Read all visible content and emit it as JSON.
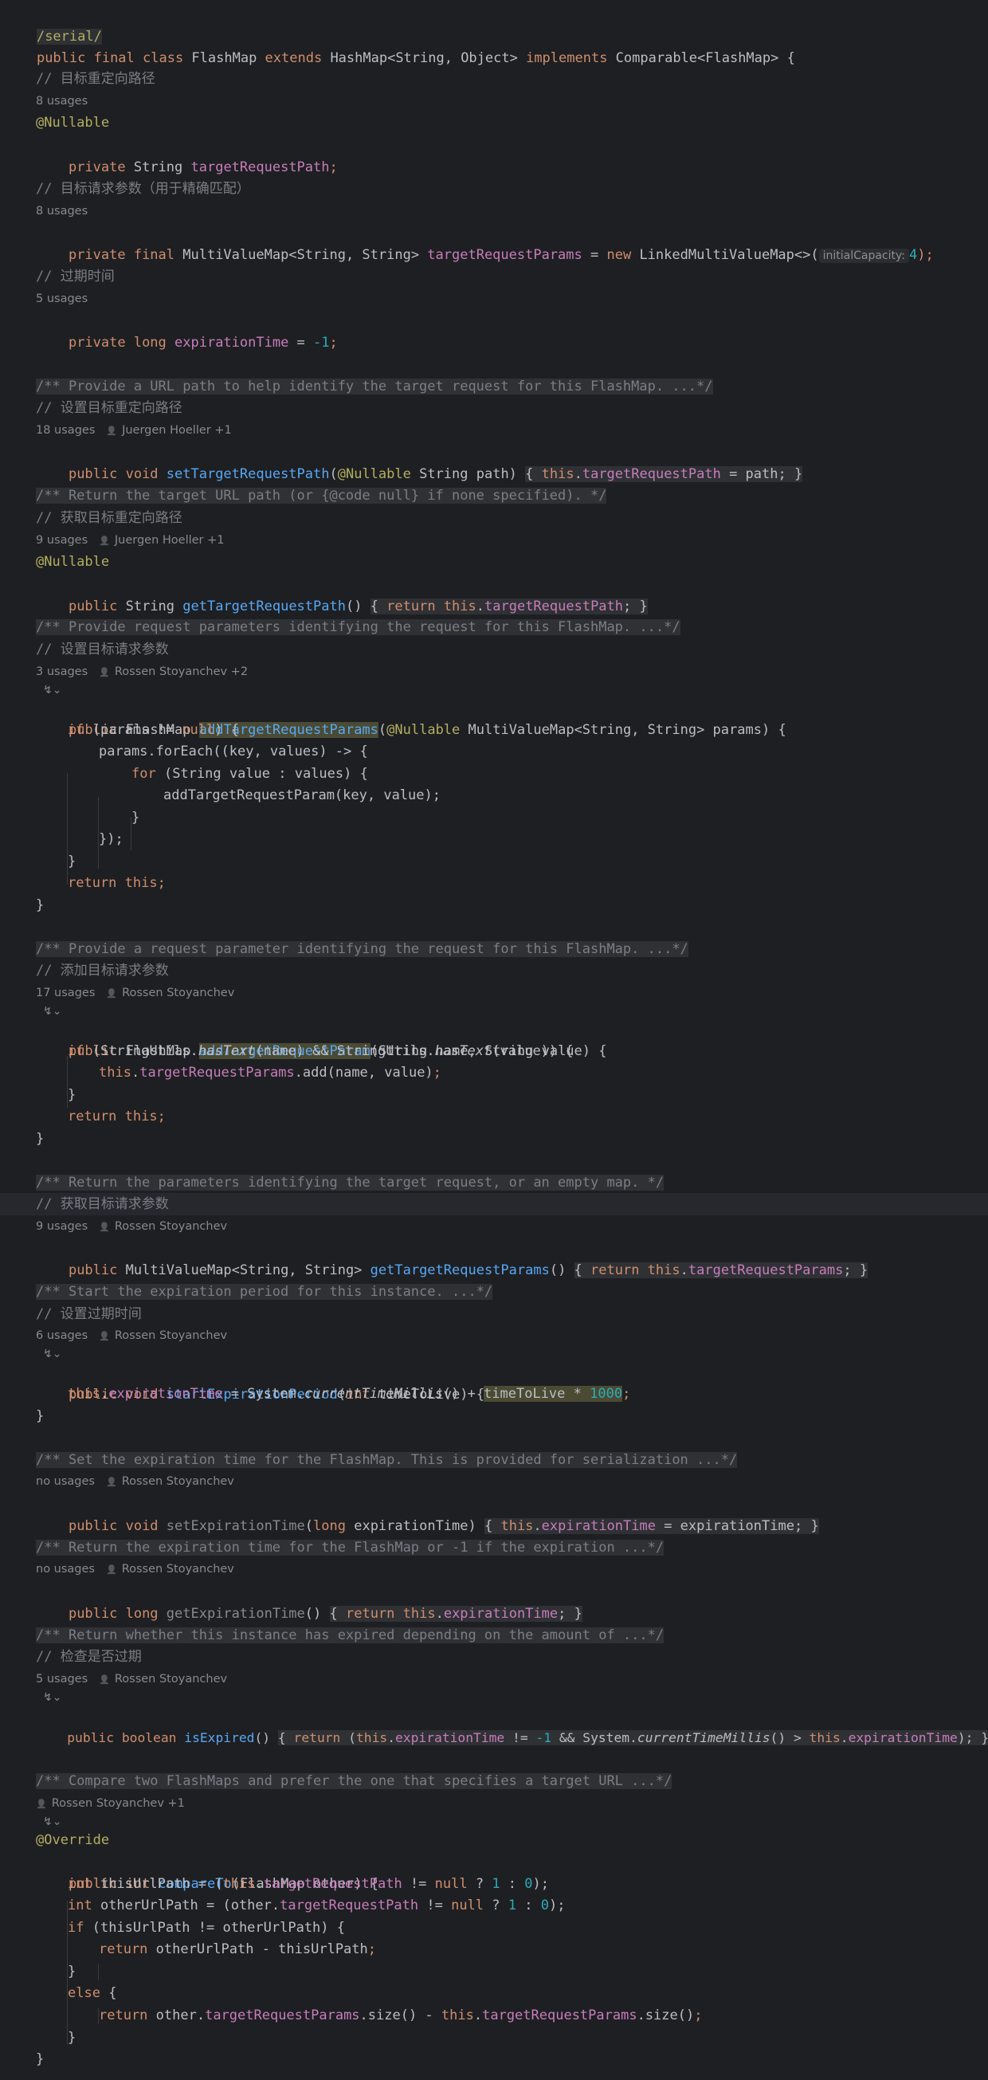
{
  "editor": {
    "annotation_serial": "/serial/",
    "class_line": "public final class FlashMap extends HashMap<String, Object> implements Comparable<FlashMap> {",
    "field_path": {
      "comment": "// 目标重定向路径",
      "usages": "8 usages",
      "annotation": "@Nullable",
      "decl_kw": "private ",
      "decl_type": "String ",
      "decl_name": "targetRequestPath",
      "decl_end": ";"
    },
    "field_params": {
      "comment": "// 目标请求参数（用于精确匹配）",
      "usages": "8 usages",
      "decl_kw": "private final ",
      "decl_type": "MultiValueMap<String, String> ",
      "decl_name": "targetRequestParams",
      "decl_eq": " = ",
      "decl_new": "new ",
      "decl_ctor": "LinkedMultiValueMap<>(",
      "hint": "initialCapacity:",
      "arg": "4",
      "decl_end": ");"
    },
    "field_exp": {
      "comment": "// 过期时间",
      "usages": "5 usages",
      "decl_kw": "private long ",
      "decl_name": "expirationTime",
      "decl_eq": " = ",
      "arg": "-1",
      "decl_end": ";"
    },
    "m_setPath": {
      "doc": "/** Provide a URL path to help identify the target request for this FlashMap. ...*/",
      "comment": "// 设置目标重定向路径",
      "usages": "18 usages",
      "author": "Juergen Hoeller +1",
      "kw": "public void ",
      "name": "setTargetRequestPath",
      "ann": "@Nullable",
      "params": " String path) ",
      "body_open": "{ ",
      "this": "this",
      "field": "targetRequestPath",
      "rest": " = path",
      "body_close": "; }"
    },
    "m_getPath": {
      "doc": "/** Return the target URL path (or {@code null} if none specified). */",
      "comment": "// 获取目标重定向路径",
      "usages": "9 usages",
      "author": "Juergen Hoeller +1",
      "annotation": "@Nullable",
      "kw": "public ",
      "type": "String ",
      "name": "getTargetRequestPath",
      "parens": "() ",
      "body_open": "{ ",
      "ret": "return this",
      "field": "targetRequestPath",
      "body_close": "; }"
    },
    "m_addParams": {
      "doc": "/** Provide request parameters identifying the request for this FlashMap. ...*/",
      "comment": "// 设置目标请求参数",
      "usages": "3 usages",
      "author": "Rossen Stoyanchev +2",
      "gutter": "↯⌄",
      "kw": "public ",
      "type": "FlashMap ",
      "name": "addTargetRequestParams",
      "ann": "@Nullable",
      "params": " MultiValueMap<String, String> params) {",
      "l1_kw": "if",
      "l1_a": " (params != ",
      "l1_null": "null",
      "l1_b": ") {",
      "l2": "params.forEach((key, values) -> {",
      "l3_kw": "for",
      "l3": " (String value : values) {",
      "l4": "addTargetRequestParam(key, value);",
      "l4_end": ";",
      "close4": "}",
      "close3": "});",
      "close2": "}",
      "ret_kw": "return this",
      "ret_end": ";",
      "close1": "}"
    },
    "m_addParam": {
      "doc": "/** Provide a request parameter identifying the request for this FlashMap. ...*/",
      "comment": "// 添加目标请求参数",
      "usages": "17 usages",
      "author": "Rossen Stoyanchev",
      "gutter": "↯⌄",
      "kw": "public ",
      "type": "FlashMap ",
      "name": "addTargetRequestParam",
      "params": "(String name, String value) {",
      "l1_kw": "if",
      "l1_a": " (StringUtils.",
      "l1_m1": "hasText",
      "l1_b": "(name) && StringUtils.",
      "l1_m2": "hasText",
      "l1_c": "(value)) {",
      "l2_this": "this",
      "l2_dot": ".",
      "l2_field": "targetRequestParams",
      "l2_rest": ".add(name, value)",
      "l2_end": ";",
      "close2": "}",
      "ret_kw": "return this",
      "ret_end": ";",
      "close1": "}"
    },
    "m_getParams": {
      "doc": "/** Return the parameters identifying the target request, or an empty map. */",
      "comment": "// 获取目标请求参数",
      "usages": "9 usages",
      "author": "Rossen Stoyanchev",
      "kw": "public ",
      "type": "MultiValueMap<String, String> ",
      "name": "getTargetRequestParams",
      "parens": "() ",
      "body_open": "{ ",
      "ret": "return this",
      "field": "targetRequestParams",
      "body_close": "; }"
    },
    "m_start": {
      "doc": "/** Start the expiration period for this instance. ...*/",
      "comment": "// 设置过期时间",
      "usages": "6 usages",
      "author": "Rossen Stoyanchev",
      "gutter": "↯⌄",
      "kw": "public void ",
      "name": "startExpirationPeriod",
      "params_a": "(",
      "params_kw": "int",
      "params_b": " timeToLive) {",
      "l1_this": "this",
      "l1_dot": ".",
      "l1_field": "expirationTime",
      "l1_a": " = System.",
      "l1_m": "currentTimeMillis",
      "l1_b": "() + ",
      "l1_hl": "timeToLive * ",
      "l1_num": "1000",
      "l1_end": ";",
      "close1": "}"
    },
    "m_setExp": {
      "doc": "/** Set the expiration time for the FlashMap. This is provided for serialization ...*/",
      "usages": "no usages",
      "author": "Rossen Stoyanchev",
      "kw": "public void ",
      "name": "setExpirationTime",
      "params_a": "(",
      "params_kw": "long",
      "params_b": " expirationTime) ",
      "body_open": "{ ",
      "this": "this",
      "dot": ".",
      "field": "expirationTime",
      "rest": " = expirationTime",
      "body_close": "; }"
    },
    "m_getExp": {
      "doc": "/** Return the expiration time for the FlashMap or -1 if the expiration ...*/",
      "usages": "no usages",
      "author": "Rossen Stoyanchev",
      "kw": "public long ",
      "name": "getExpirationTime",
      "parens": "() ",
      "body_open": "{ ",
      "ret": "return this",
      "dot": ".",
      "field": "expirationTime",
      "body_close": "; }"
    },
    "m_isExpired": {
      "doc": "/** Return whether this instance has expired depending on the amount of ...*/",
      "comment": "// 检查是否过期",
      "usages": "5 usages",
      "author": "Rossen Stoyanchev",
      "gutter": "↯⌄",
      "kw": "public boolean ",
      "name": "isExpired",
      "parens": "() ",
      "body_open": "{ ",
      "ret": "return",
      "a": " (",
      "this1": "this",
      "dot1": ".",
      "field1": "expirationTime",
      "b": " != ",
      "num": "-1",
      "c": " && System.",
      "m": "currentTimeMillis",
      "d": "() > ",
      "this2": "this",
      "dot2": ".",
      "field2": "expirationTime",
      "e": ")",
      "body_close": "; }"
    },
    "m_compare": {
      "doc": "/** Compare two FlashMaps and prefer the one that specifies a target URL ...*/",
      "author": "Rossen Stoyanchev +1",
      "gutter": "↯⌄",
      "annotation": "@Override",
      "kw": "public int ",
      "name": "compareTo",
      "params": "(FlashMap other) {",
      "l1_kw": "int",
      "l1_a": " thisUrlPath = (",
      "l1_this": "this",
      "l1_dot": ".",
      "l1_field": "targetRequestPath",
      "l1_b": " != ",
      "l1_null": "null",
      "l1_c": " ? ",
      "l1_n1": "1",
      "l1_d": " : ",
      "l1_n0": "0",
      "l1_e": ");",
      "l2_kw": "int",
      "l2_a": " otherUrlPath = (other.",
      "l2_field": "targetRequestPath",
      "l2_b": " != ",
      "l2_null": "null",
      "l2_c": " ? ",
      "l2_n1": "1",
      "l2_d": " : ",
      "l2_n0": "0",
      "l2_e": ");",
      "l3_kw": "if",
      "l3": " (thisUrlPath != otherUrlPath) {",
      "l4_kw": "return",
      "l4": " otherUrlPath - thisUrlPath",
      "l4_end": ";",
      "l5": "}",
      "l6_kw": "else",
      "l6": " {",
      "l7_kw": "return",
      "l7_a": " other.",
      "l7_f1": "targetRequestParams",
      "l7_b": ".size() - ",
      "l7_this": "this",
      "l7_dot": ".",
      "l7_f2": "targetRequestParams",
      "l7_c": ".size()",
      "l7_end": ";",
      "l8": "}",
      "close1": "}"
    }
  }
}
